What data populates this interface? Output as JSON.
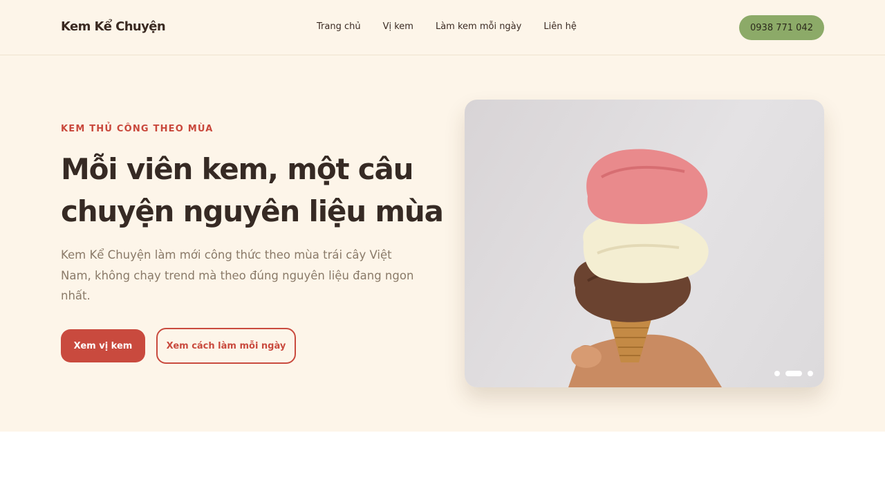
{
  "header": {
    "logo": "Kem Kể Chuyện",
    "nav": [
      {
        "label": "Trang chủ"
      },
      {
        "label": "Vị kem"
      },
      {
        "label": "Làm kem mỗi ngày"
      },
      {
        "label": "Liên hệ"
      }
    ],
    "phone": "0938 771 042"
  },
  "hero": {
    "eyebrow": "KEM THỦ CÔNG THEO MÙA",
    "headline_line1": "Mỗi viên kem, một câu",
    "headline_line2": "chuyện nguyên liệu mùa",
    "subtext": "Kem Kể Chuyện làm mới công thức theo mùa trái cây Việt Nam, không chạy trend mà theo đúng nguyên liệu đang ngon nhất.",
    "primary_button": "Xem vị kem",
    "secondary_button": "Xem cách làm mỗi ngày"
  },
  "carousel": {
    "slide_count": 3,
    "active_index": 1
  },
  "colors": {
    "background": "#fdf5e9",
    "accent": "#c94a3e",
    "phone_button": "#8caa68",
    "heading": "#362a24",
    "body_text": "#8a7a68"
  }
}
